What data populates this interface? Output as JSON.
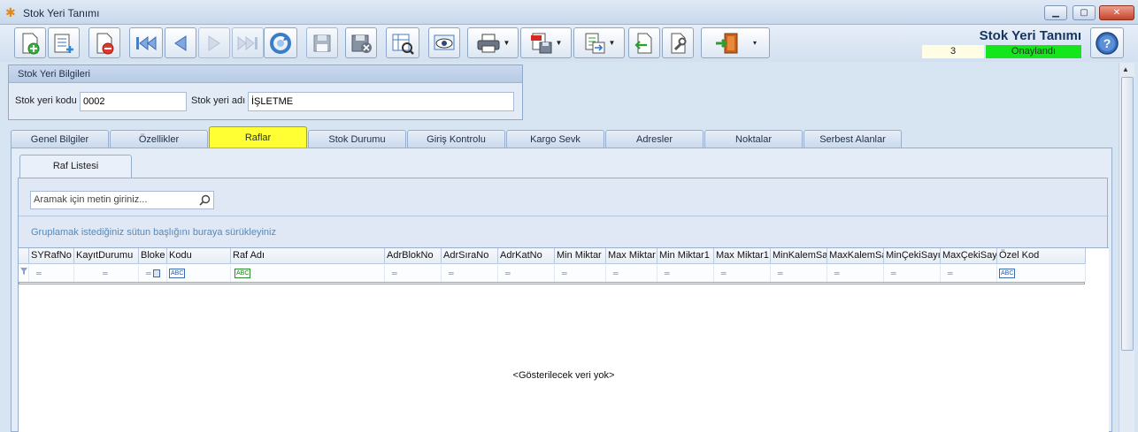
{
  "window": {
    "title": "Stok Yeri Tanımı",
    "minimize": "▁",
    "maximize": "▢",
    "close": "✕"
  },
  "header": {
    "form_title": "Stok Yeri Tanımı",
    "record_number": "3",
    "status": "Onaylandı",
    "status_color": "#15e51d"
  },
  "toolbar": {
    "icons": [
      "new-document-icon",
      "new-list-icon",
      "delete-icon",
      "first-record-icon",
      "previous-record-icon",
      "next-record-icon",
      "last-record-icon",
      "refresh-icon",
      "save-icon",
      "save-cancel-icon",
      "preview-icon",
      "view-icon",
      "print-icon",
      "pdf-export-icon",
      "export-icon",
      "import-icon",
      "tools-icon",
      "exit-icon",
      "help-icon"
    ]
  },
  "info": {
    "header": "Stok Yeri Bilgileri",
    "code_label": "Stok yeri kodu",
    "code_value": "0002",
    "name_label": "Stok yeri adı",
    "name_value": "İŞLETME"
  },
  "tabs": [
    {
      "label": "Genel Bilgiler"
    },
    {
      "label": "Özellikler"
    },
    {
      "label": "Raflar",
      "active": true
    },
    {
      "label": "Stok Durumu"
    },
    {
      "label": "Giriş Kontrolu"
    },
    {
      "label": "Kargo Sevk"
    },
    {
      "label": "Adresler"
    },
    {
      "label": "Noktalar"
    },
    {
      "label": "Serbest Alanlar"
    }
  ],
  "subtab": {
    "label": "Raf Listesi"
  },
  "search": {
    "placeholder": "Aramak için metin giriniz..."
  },
  "group_hint": "Gruplamak istediğiniz sütun başlığını buraya sürükleyiniz",
  "grid": {
    "columns": [
      "SYRafNo",
      "KayıtDurumu",
      "Bloke",
      "Kodu",
      "Raf Adı",
      "AdrBlokNo",
      "AdrSıraNo",
      "AdrKatNo",
      "Min Miktar",
      "Max Miktar",
      "Min Miktar1",
      "Max Miktar1",
      "MinKalemSayısı",
      "MaxKalemSayısı",
      "MinÇekiSayısı",
      "MaxÇekiSayısı",
      "Özel Kod"
    ],
    "filter_text_marker": "ABC",
    "empty_message": "<Gösterilecek veri yok>"
  }
}
